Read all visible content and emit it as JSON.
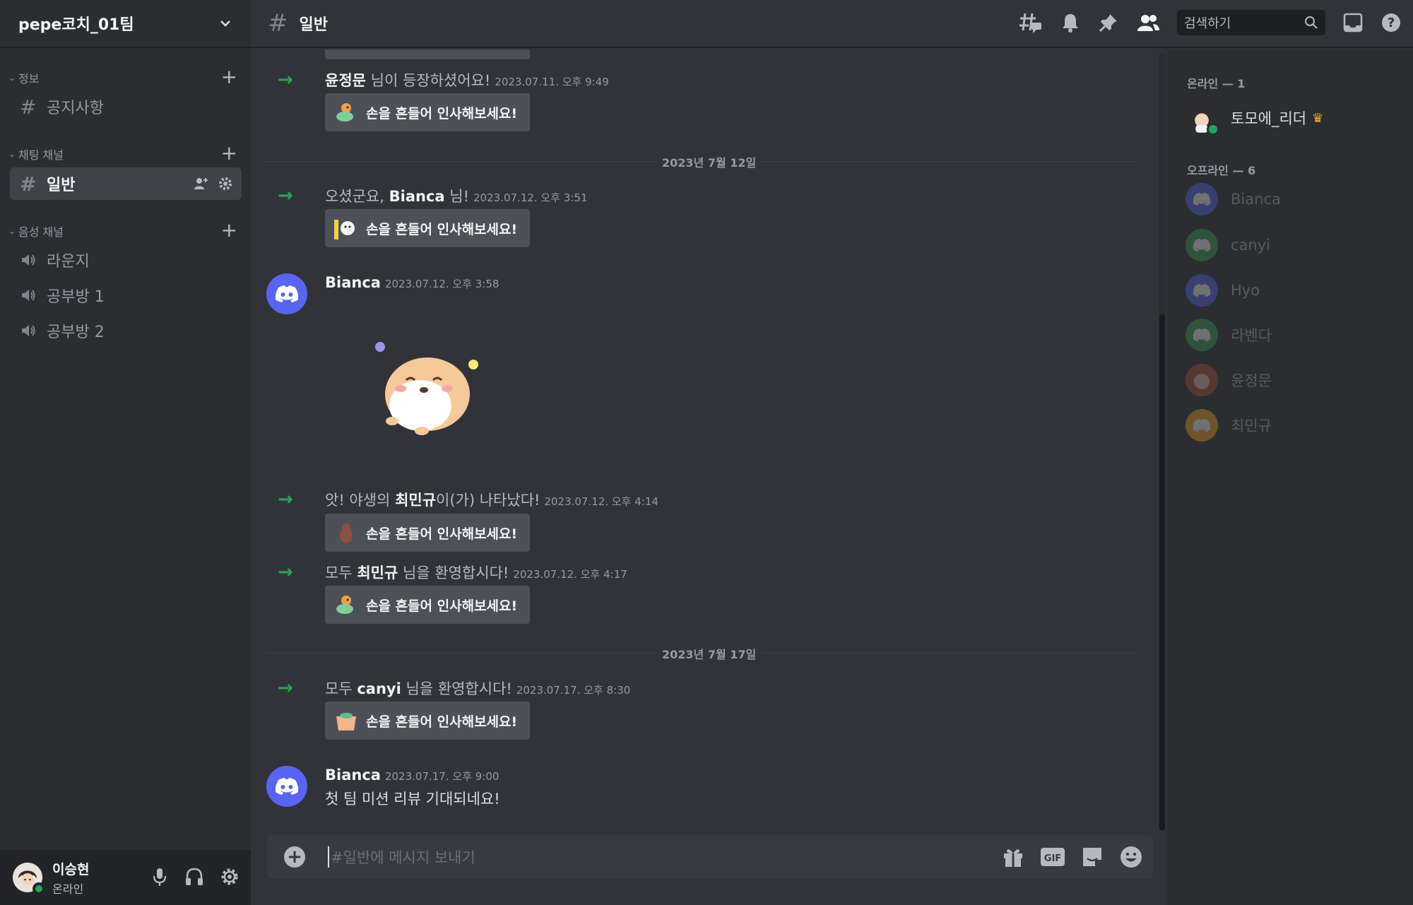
{
  "server": {
    "name": "pepe코치_01팀"
  },
  "sidebar": {
    "categories": [
      {
        "name": "정보"
      },
      {
        "name": "채팅 채널"
      },
      {
        "name": "음성 채널"
      }
    ],
    "text_channels": [
      {
        "name": "공지사항"
      },
      {
        "name": "일반"
      }
    ],
    "voice_channels": [
      {
        "name": "라운지"
      },
      {
        "name": "공부방 1"
      },
      {
        "name": "공부방 2"
      }
    ]
  },
  "user": {
    "name": "이승현",
    "status": "온라인"
  },
  "topbar": {
    "channel": "일반",
    "search_placeholder": "검색하기"
  },
  "messages": {
    "m1": {
      "user": "윤정문",
      "text": " 님이 등장하셨어요!",
      "ts": "2023.07.11. 오후 9:49"
    },
    "wave_label": "손을 흔들어 인사해보세요!",
    "div1": "2023년 7월 12일",
    "m2": {
      "pre": "오셨군요, ",
      "user": "Bianca",
      "post": " 님!",
      "ts": "2023.07.12. 오후 3:51"
    },
    "m3": {
      "user": "Bianca",
      "ts": "2023.07.12. 오후 3:58"
    },
    "m4": {
      "pre": "앗! 야생의 ",
      "user": "최민규",
      "post": "이(가) 나타났다!",
      "ts": "2023.07.12. 오후 4:14"
    },
    "m5": {
      "pre": "모두 ",
      "user": "최민규",
      "post": " 님을 환영합시다!",
      "ts": "2023.07.12. 오후 4:17"
    },
    "div2": "2023년 7월 17일",
    "m6": {
      "pre": "모두 ",
      "user": "canyi",
      "post": " 님을 환영합시다!",
      "ts": "2023.07.17. 오후 8:30"
    },
    "m7": {
      "user": "Bianca",
      "ts": "2023.07.17. 오후 9:00",
      "text": "첫 팀 미션 리뷰 기대되네요!"
    }
  },
  "composer": {
    "placeholder": "#일반에 메시지 보내기",
    "gif_label": "GIF"
  },
  "members": {
    "online_header": "온라인 — 1",
    "online": [
      {
        "name": "토모에_리더"
      }
    ],
    "offline_header": "오프라인 — 6",
    "offline": [
      {
        "name": "Bianca",
        "color": "#5865f2"
      },
      {
        "name": "canyi",
        "color": "#3ba55c"
      },
      {
        "name": "Hyo",
        "color": "#5865f2"
      },
      {
        "name": "라벤다",
        "color": "#3ba55c"
      },
      {
        "name": "윤정문",
        "color": "#c27c4e"
      },
      {
        "name": "최민규",
        "color": "#faa61a"
      }
    ]
  }
}
